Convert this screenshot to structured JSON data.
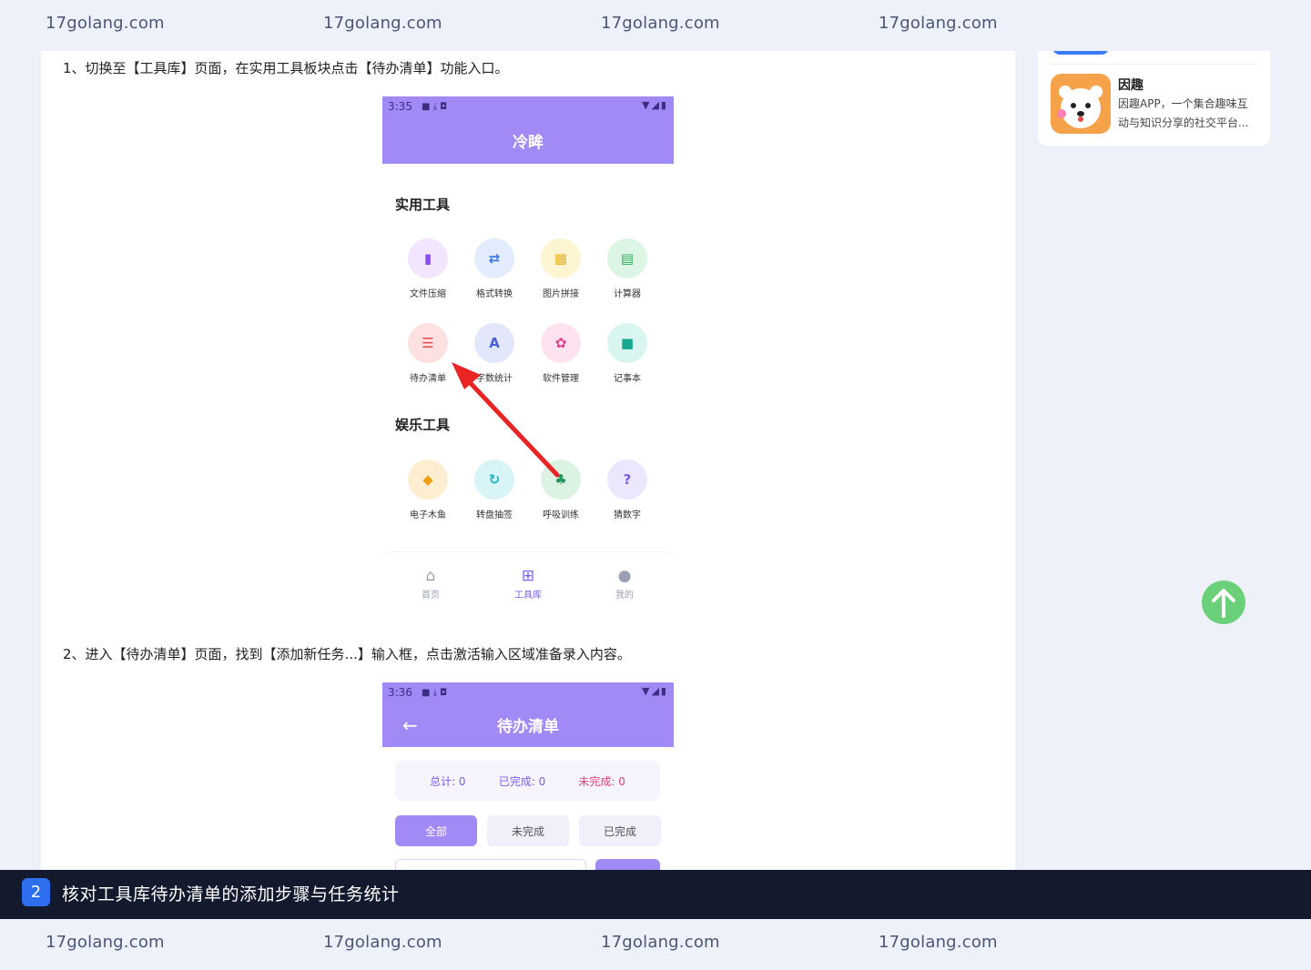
{
  "watermarks": {
    "top": [
      "17golang.com",
      "17golang.com",
      "17golang.com",
      "17golang.com"
    ],
    "bottom": [
      "17golang.com",
      "17golang.com",
      "17golang.com",
      "17golang.com"
    ]
  },
  "article": {
    "step1": "1、切换至【工具库】页面，在实用工具板块点击【待办清单】功能入口。",
    "step2": "2、进入【待办清单】页面，找到【添加新任务...】输入框，点击激活输入区域准备录入内容。"
  },
  "screenshot1": {
    "time": "3:35",
    "app_title": "冷眸",
    "section_practical": "实用工具",
    "practical_tools": [
      {
        "label": "文件压缩",
        "icon": "file-zip-icon",
        "glyph": "▮",
        "color": "#8a4df0"
      },
      {
        "label": "格式转换",
        "icon": "swap-icon",
        "glyph": "⇄",
        "color": "#3c7be8"
      },
      {
        "label": "图片拼接",
        "icon": "grid-icon",
        "glyph": "▦",
        "color": "#e8b21b"
      },
      {
        "label": "计算器",
        "icon": "calculator-icon",
        "glyph": "▤",
        "color": "#2fae5b"
      },
      {
        "label": "待办清单",
        "icon": "checklist-icon",
        "glyph": "☰",
        "color": "#e64848"
      },
      {
        "label": "字数统计",
        "icon": "font-icon",
        "glyph": "A",
        "color": "#4a5fd8"
      },
      {
        "label": "软件管理",
        "icon": "settings-icon",
        "glyph": "✿",
        "color": "#e43d8e"
      },
      {
        "label": "记事本",
        "icon": "note-icon",
        "glyph": "■",
        "color": "#18a88f"
      }
    ],
    "section_entertainment": "娱乐工具",
    "entertainment_tools": [
      {
        "label": "电子木鱼",
        "icon": "fish-icon",
        "glyph": "◆",
        "color": "#f0a018"
      },
      {
        "label": "转盘抽签",
        "icon": "refresh-icon",
        "glyph": "↻",
        "color": "#1fb5c2"
      },
      {
        "label": "呼吸训练",
        "icon": "lungs-icon",
        "glyph": "♣",
        "color": "#1f9a5a"
      },
      {
        "label": "猜数字",
        "icon": "question-icon",
        "glyph": "?",
        "color": "#7b5cf0"
      }
    ],
    "nav": [
      {
        "label": "首页",
        "icon": "home-icon",
        "glyph": "⌂"
      },
      {
        "label": "工具库",
        "icon": "toolbox-icon",
        "glyph": "⊞"
      },
      {
        "label": "我的",
        "icon": "user-icon",
        "glyph": "●"
      }
    ]
  },
  "screenshot2": {
    "time": "3:36",
    "app_title": "待办清单",
    "stats": {
      "total": "总计: 0",
      "done": "已完成: 0",
      "undone": "未完成: 0"
    },
    "filters": [
      "全部",
      "未完成",
      "已完成"
    ]
  },
  "sidebar": {
    "app_name": "因趣",
    "app_desc": "因趣APP，一个集合趣味互动与知识分享的社交平台..."
  },
  "caption": {
    "step_number": "2",
    "text": "核对工具库待办清单的添加步骤与任务统计"
  },
  "colors": {
    "accent_purple": "#a18af5",
    "caption_bg": "#141a2e",
    "badge_blue": "#2e6ff2",
    "back_to_top_green": "#6ad17a",
    "arrow_red": "#e82424"
  }
}
